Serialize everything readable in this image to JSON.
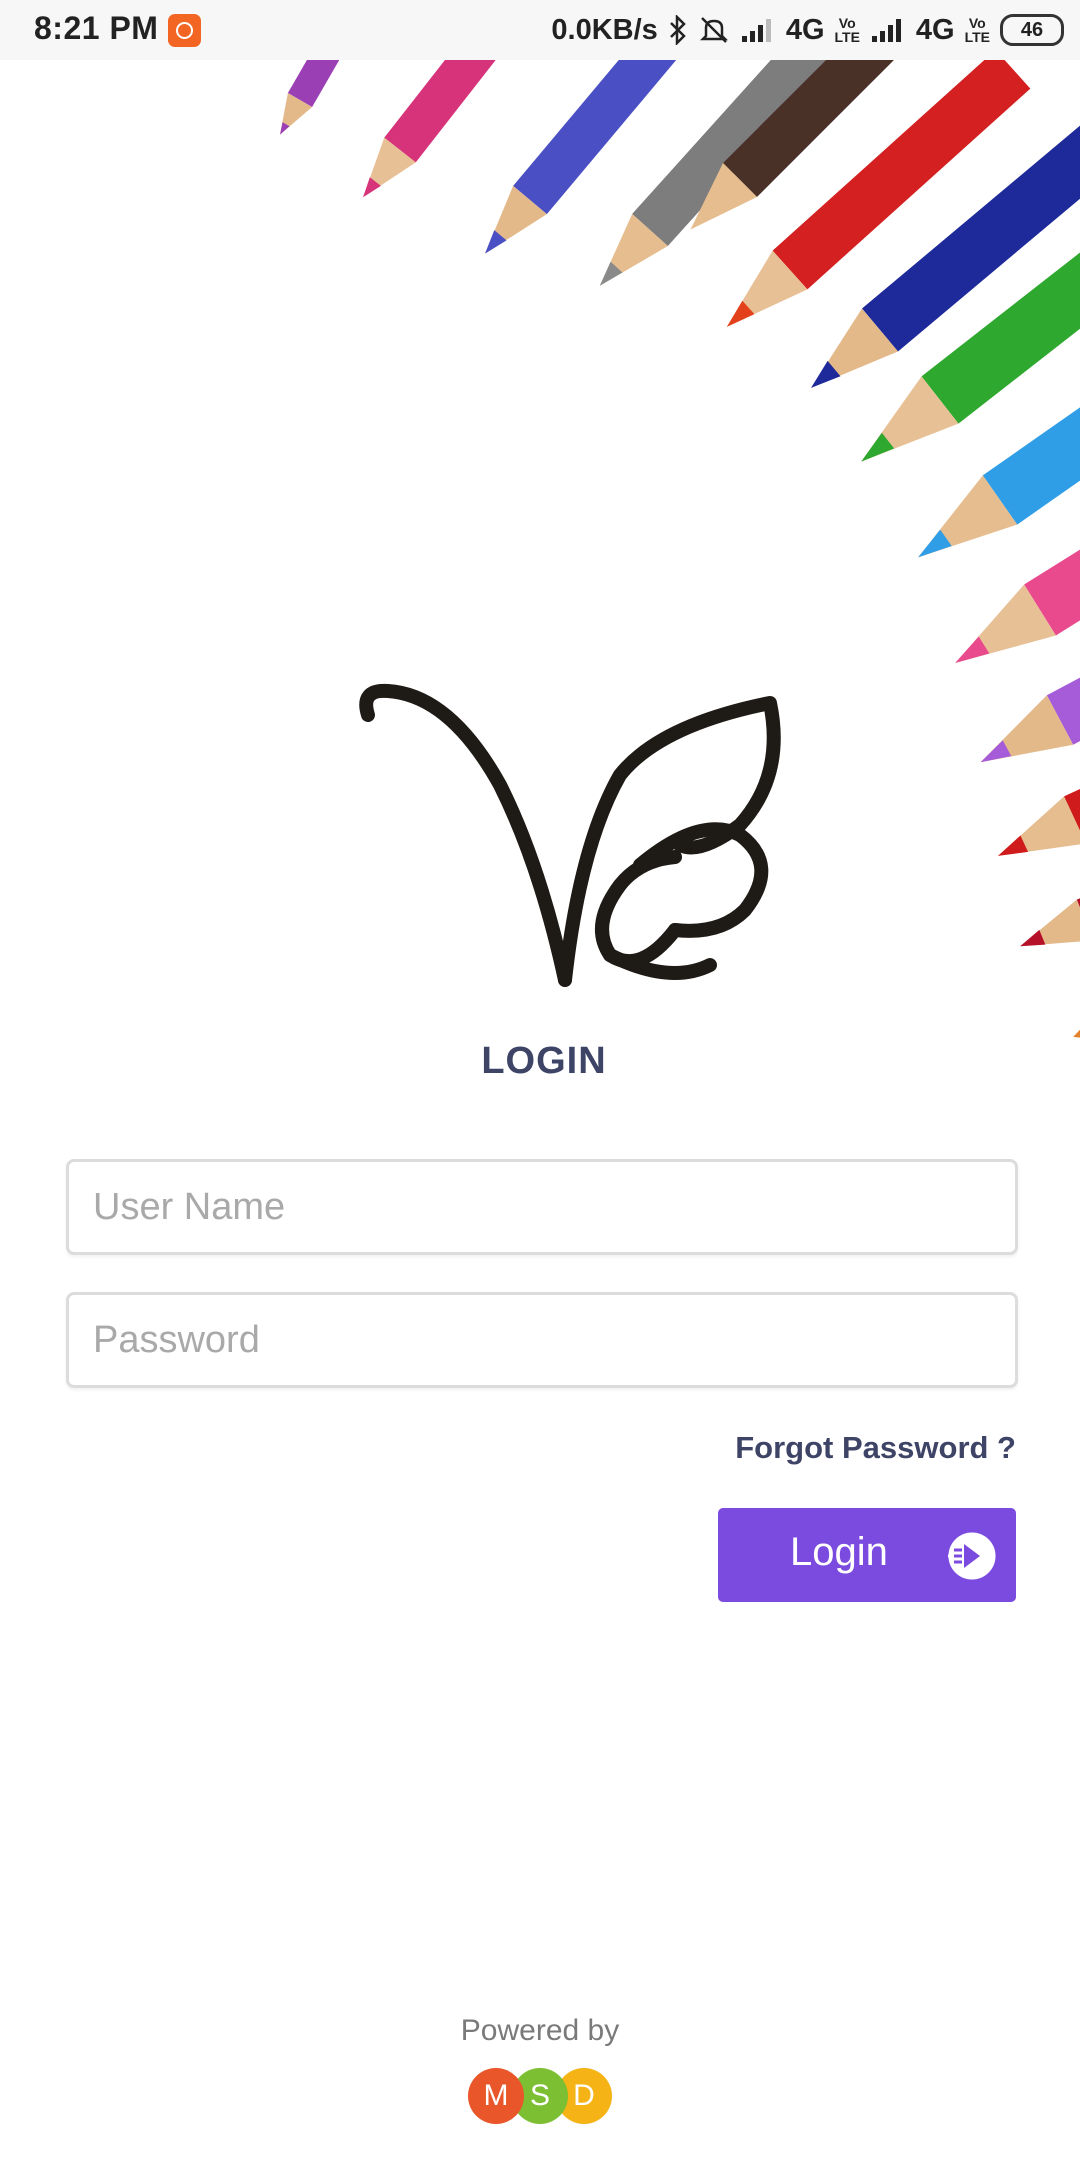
{
  "status_bar": {
    "time": "8:21 PM",
    "speed": "0.0KB/s",
    "network_1": "4G",
    "network_2": "4G",
    "volte_top": "Vo",
    "volte_bottom": "LTE",
    "battery": "46",
    "icons": [
      "notification-app-icon",
      "bluetooth-icon",
      "mute-icon",
      "signal-icon",
      "signal-icon",
      "battery-icon"
    ]
  },
  "header": {
    "decoration": "colored-pencils-image",
    "logo": "butterfly-logo-icon"
  },
  "login": {
    "title": "LOGIN",
    "username_placeholder": "User Name",
    "username_value": "",
    "password_placeholder": "Password",
    "password_value": "",
    "forgot_label": "Forgot Password ?",
    "button_label": "Login",
    "button_icon": "arrow-right-circle-icon"
  },
  "footer": {
    "powered_by": "Powered by",
    "brand_letters": [
      "M",
      "S",
      "D"
    ],
    "brand_colors": [
      "#e8562a",
      "#7cbf32",
      "#f5b316"
    ]
  },
  "colors": {
    "accent": "#7b4be0",
    "heading": "#3d4466"
  }
}
